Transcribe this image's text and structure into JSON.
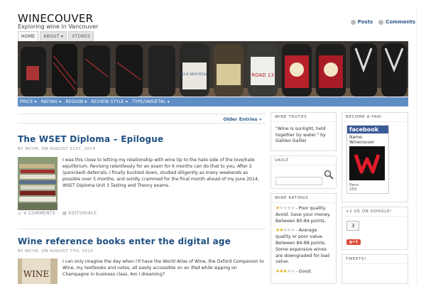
{
  "site": {
    "title": "WINECOUVER",
    "description": "Exploring wine in Vancouver"
  },
  "feeds": {
    "posts_label": "Posts",
    "comments_label": "Comments"
  },
  "nav": {
    "tabs": [
      {
        "label": "HOME",
        "active": true
      },
      {
        "label": "ABOUT ▾",
        "active": false
      },
      {
        "label": "STORES",
        "active": false
      }
    ]
  },
  "banner": {
    "bottle_labels": [
      "ROAD 13",
      "BLUE MOUNTAIN"
    ]
  },
  "categories": [
    "PRICE ▾",
    "RATING ▾",
    "REGION ▾",
    "REVIEW STYLE ▾",
    "TYPE/VARIETAL ▾"
  ],
  "pagination": {
    "older_label": "Older Entries »"
  },
  "posts": [
    {
      "title": "The WSET Diploma – Epilogue",
      "meta": "BY WCVR, ON AUGUST 21ST, 2014",
      "text": "I was this close to letting my relationship with wine tip to the hate side of the love/hate equilibrium. Revising relentlessly for an exam for 6 months can do that to you. After 2 (panicked) deferrals, I finally buckled down, studied diligently as many weekends as possible over 5 months, and solidly crammed for the final month ahead of my June 2014, WSET Diploma Unit 3 Tasting and Theory exams.",
      "comments": "4 COMMENTS",
      "category": "EDITORIALS"
    },
    {
      "title": "Wine reference books enter the digital age",
      "meta": "BY WCVR, ON AUGUST 7TH, 2013",
      "text": "I can only imagine the day when I'll have the World Atlas of Wine, the Oxford Companion to Wine, my textbooks and notes, all easily accessible on an iPad while sipping on Champagne in business class. Am I dreaming?",
      "thumb_text": "WINE"
    }
  ],
  "sidebar": {
    "wine_truths": {
      "title": "WINE TRUTHS",
      "quote": "\"Wine is sunlight, held together by water.\" by Galileo Galilei"
    },
    "vault": {
      "title": "VAULT",
      "search_placeholder": ""
    },
    "ratings": {
      "title": "WINE RATINGS",
      "items": [
        {
          "stars": 1,
          "text": "- Poor quality. Avoid. Save your money. Between 80-84 points."
        },
        {
          "stars": 2,
          "text": "- Average quality or poor value. Between 84-88 points. Some expensive wines are downgraded for bad value."
        },
        {
          "stars": 3,
          "text": "- Good."
        }
      ]
    },
    "fan": {
      "title": "BECOME A FAN!",
      "brand": "facebook",
      "page_name_label": "Name:",
      "page_name": "Winecouver",
      "fans_label": "Fans:",
      "fans": "255"
    },
    "google": {
      "title": "+1 US ON GOOGLE!",
      "count": "3",
      "button": "g+1"
    },
    "tweets": {
      "title": "TWEETS!"
    }
  },
  "colors": {
    "accent_blue": "#1f4f82",
    "category_bar": "#5f8ec5",
    "facebook": "#3b5998",
    "star": "#e8b020"
  }
}
